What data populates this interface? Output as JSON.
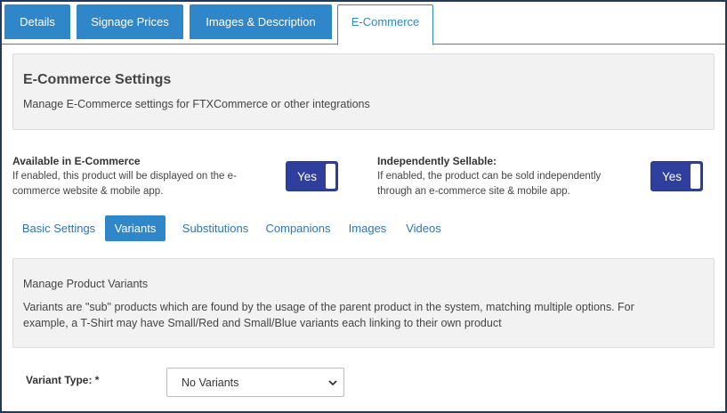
{
  "tabs": [
    {
      "label": "Details",
      "active": false
    },
    {
      "label": "Signage Prices",
      "active": false
    },
    {
      "label": "Images & Description",
      "active": false
    },
    {
      "label": "E-Commerce",
      "active": true
    }
  ],
  "ecommerce": {
    "title": "E-Commerce Settings",
    "subtitle": "Manage E-Commerce settings for FTXCommerce or other integrations"
  },
  "available": {
    "label": "Available in E-Commerce",
    "desc_line1": "If enabled, this product will be displayed on the e-",
    "desc_line2": "commerce website & mobile app.",
    "toggle": "Yes"
  },
  "sellable": {
    "label": "Independently Sellable:",
    "desc_line1": "If enabled, the product can be sold independently",
    "desc_line2": "through an e-commerce site & mobile app.",
    "toggle": "Yes"
  },
  "subtabs": [
    {
      "label": "Basic Settings",
      "active": false
    },
    {
      "label": "Variants",
      "active": true
    },
    {
      "label": "Substitutions",
      "active": false
    },
    {
      "label": "Companions",
      "active": false
    },
    {
      "label": "Images",
      "active": false
    },
    {
      "label": "Videos",
      "active": false
    }
  ],
  "variants": {
    "title": "Manage Product Variants",
    "desc_line1": "Variants are \"sub\" products which are found by the usage of the parent product in the system, matching multiple options. For",
    "desc_line2": "example, a T-Shirt may have Small/Red and Small/Blue variants each linking to their own product"
  },
  "variant_type": {
    "label": "Variant Type: *",
    "value": "No Variants"
  },
  "colors": {
    "accent": "#2f86c8",
    "toggle": "#2f3f9e",
    "panel": "#f2f2f2"
  }
}
